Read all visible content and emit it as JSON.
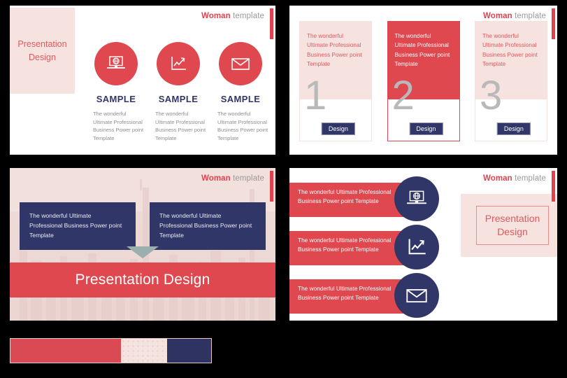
{
  "brand": {
    "name": "Woman",
    "suffix": "template"
  },
  "slide1": {
    "panel_text": "Presentation\nDesign",
    "columns": [
      {
        "icon": "laptop-globe-icon",
        "title": "SAMPLE",
        "desc": "The wonderful Ultimate Professional Business Power point Template"
      },
      {
        "icon": "line-chart-icon",
        "title": "SAMPLE",
        "desc": "The wonderful Ultimate Professional Business Power point Template"
      },
      {
        "icon": "envelope-icon",
        "title": "SAMPLE",
        "desc": "The wonderful Ultimate Professional Business Power point Template"
      }
    ]
  },
  "slide2": {
    "cards": [
      {
        "text": "The wonderful Ultimate Professional Business Power point Template",
        "number": "1",
        "button": "Design",
        "variant": "light"
      },
      {
        "text": "The wonderful Ultimate Professional Business Power point Template",
        "number": "2",
        "button": "Design",
        "variant": "accent"
      },
      {
        "text": "The wonderful Ultimate Professional Business Power point Template",
        "number": "3",
        "button": "Design",
        "variant": "light"
      }
    ]
  },
  "slide3": {
    "boxes": [
      "The wonderful Ultimate Professional Business Power point Template",
      "The wonderful Ultimate Professional Business Power point Template"
    ],
    "band_title": "Presentation Design"
  },
  "slide4": {
    "rows": [
      {
        "text": "The wonderful Ultimate Professional Business Power point Template",
        "icon": "laptop-globe-icon"
      },
      {
        "text": "The wonderful Ultimate Professional Business Power point Template",
        "icon": "line-chart-icon"
      },
      {
        "text": "The wonderful Ultimate Professional Business Power point Template",
        "icon": "envelope-icon"
      }
    ],
    "panel_text": "Presentation\nDesign"
  },
  "palette": {
    "swatches": [
      {
        "name": "accent-red",
        "hex": "#D94A55"
      },
      {
        "name": "light-pink",
        "hex": "#F5E3E0"
      },
      {
        "name": "navy",
        "hex": "#2E3361"
      }
    ]
  }
}
